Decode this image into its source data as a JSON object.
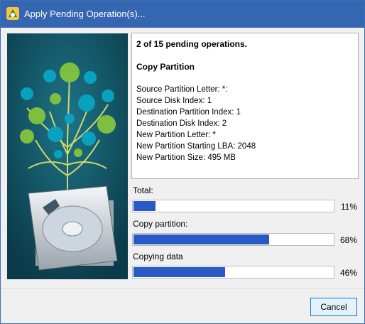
{
  "window": {
    "title": "Apply Pending Operation(s)..."
  },
  "operation": {
    "header": "2 of 15 pending operations.",
    "name": "Copy Partition",
    "details": [
      "Source Partition Letter: *:",
      "Source Disk Index: 1",
      "Destination Partition Index: 1",
      "Destination Disk Index: 2",
      "New Partition Letter: *",
      "New Partition Starting LBA: 2048",
      "New Partition Size: 495 MB"
    ]
  },
  "progress": [
    {
      "label": "Total:",
      "percent_text": "11%",
      "value": 0.11
    },
    {
      "label": "Copy partition:",
      "percent_text": "68%",
      "value": 0.68
    },
    {
      "label": "Copying data",
      "percent_text": "46%",
      "value": 0.46
    }
  ],
  "buttons": {
    "cancel_label": "Cancel"
  },
  "colors": {
    "titlebar": "#3566b1",
    "progress_fill": "#2a5ac7",
    "side_panel": "#0f4a5c"
  },
  "icons": [
    "app-icon",
    "hard-disk-illustration"
  ]
}
